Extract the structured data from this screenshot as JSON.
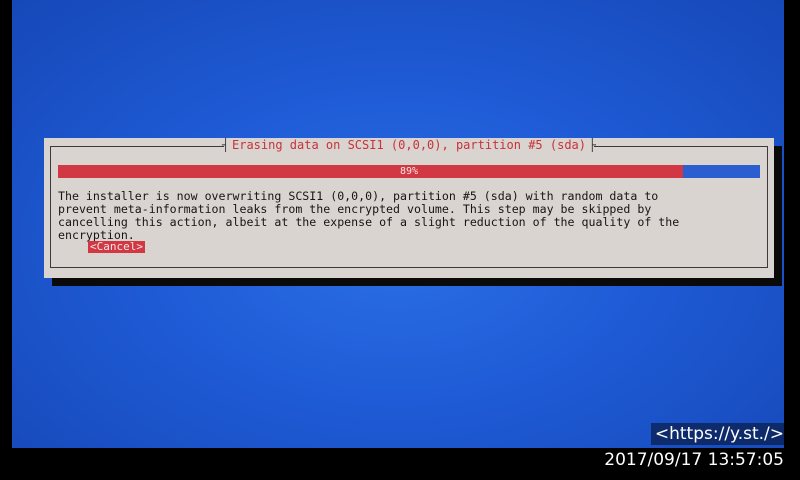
{
  "dialog": {
    "title": "Erasing data on SCSI1 (0,0,0), partition #5 (sda)",
    "progress_label": "89%",
    "progress_fraction": 0.89,
    "message": "The installer is now overwriting SCSI1 (0,0,0), partition #5 (sda) with random data to\nprevent meta-information leaks from the encrypted volume. This step may be skipped by\ncancelling this action, albeit at the expense of a slight reduction of the quality of the\nencryption.",
    "cancel_label": "<Cancel>"
  },
  "overlay": {
    "url": "<https://y.st./>",
    "timestamp": "2017/09/17 13:57:05"
  },
  "colors": {
    "background_blue": "#1f5bd6",
    "dialog_bg": "#d9d4cf",
    "accent_red": "#d23843",
    "progress_empty": "#2b5fd0"
  }
}
